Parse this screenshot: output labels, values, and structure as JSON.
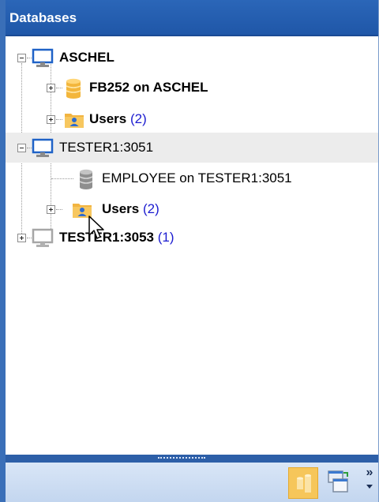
{
  "panel": {
    "title": "Databases"
  },
  "tree": {
    "servers": [
      {
        "name": "ASCHEL",
        "children": [
          {
            "label": "FB252 on ASCHEL"
          },
          {
            "label": "Users",
            "count": "(2)"
          }
        ]
      },
      {
        "name": "TESTER1:3051",
        "children": [
          {
            "label": "EMPLOYEE on TESTER1:3051"
          },
          {
            "label": "Users",
            "count": "(2)"
          }
        ]
      },
      {
        "name": "TESTER1:3053",
        "count": "(1)"
      }
    ]
  },
  "bottombar": {
    "overflow_glyph": "»"
  },
  "icons": {
    "server": "monitor-icon",
    "database": "database-icon",
    "users": "users-folder-icon"
  },
  "colors": {
    "titlebar": "#2b66b8",
    "selection": "#ececec",
    "count": "#1c1cd0",
    "database_active": "#f6c65a"
  }
}
